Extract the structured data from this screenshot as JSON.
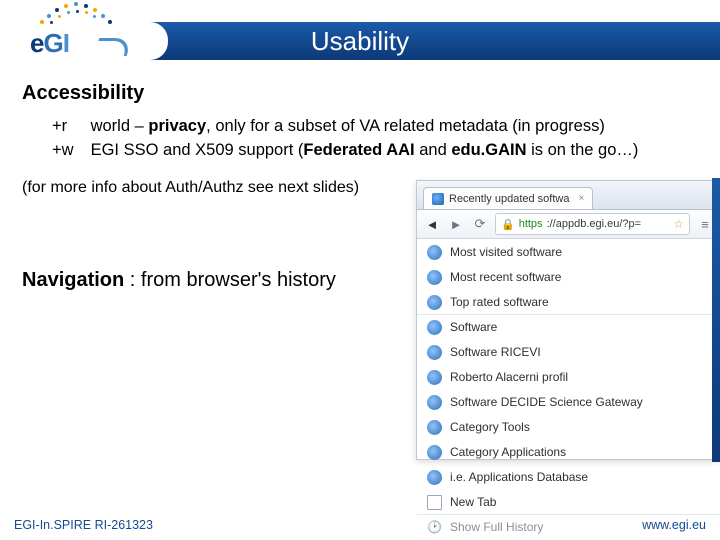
{
  "header": {
    "title": "Usability"
  },
  "logo": {
    "e": "e",
    "g": "G",
    "i": "I"
  },
  "section1": {
    "heading": "Accessibility",
    "r_tag": "+r",
    "r_text1": "world – ",
    "r_bold": "privacy",
    "r_text2": ", only for a subset of VA related metadata (in progress)",
    "w_tag": "+w",
    "w_text1": "EGI SSO and X509 support (",
    "w_bold1": "Federated AAI",
    "w_text2": " and ",
    "w_bold2": "edu.GAIN",
    "w_text3": " is on the go…)",
    "note": "(for more info about Auth/Authz see next slides)"
  },
  "nav": {
    "bold": "Navigation",
    "rest": " : from browser's history"
  },
  "browser": {
    "tab_title": "Recently updated softwa",
    "tab_close": "×",
    "url_https": "https",
    "url_rest": "://appdb.egi.eu/?p=",
    "ham": "≡",
    "items": [
      {
        "label": "Most visited software"
      },
      {
        "label": "Most recent software"
      },
      {
        "label": "Top rated software"
      },
      {
        "label": "Software"
      },
      {
        "label": "Software RICEVI"
      },
      {
        "label": "Roberto Alacerni profil"
      },
      {
        "label": "Software DECIDE Science Gateway"
      },
      {
        "label": "Category Tools"
      },
      {
        "label": "Category Applications"
      },
      {
        "label": "i.e. Applications Database"
      },
      {
        "label": "New Tab"
      }
    ],
    "history": "Show Full History"
  },
  "footer": {
    "left": "EGI-In.SPIRE RI-261323",
    "right": "www.egi.eu"
  }
}
